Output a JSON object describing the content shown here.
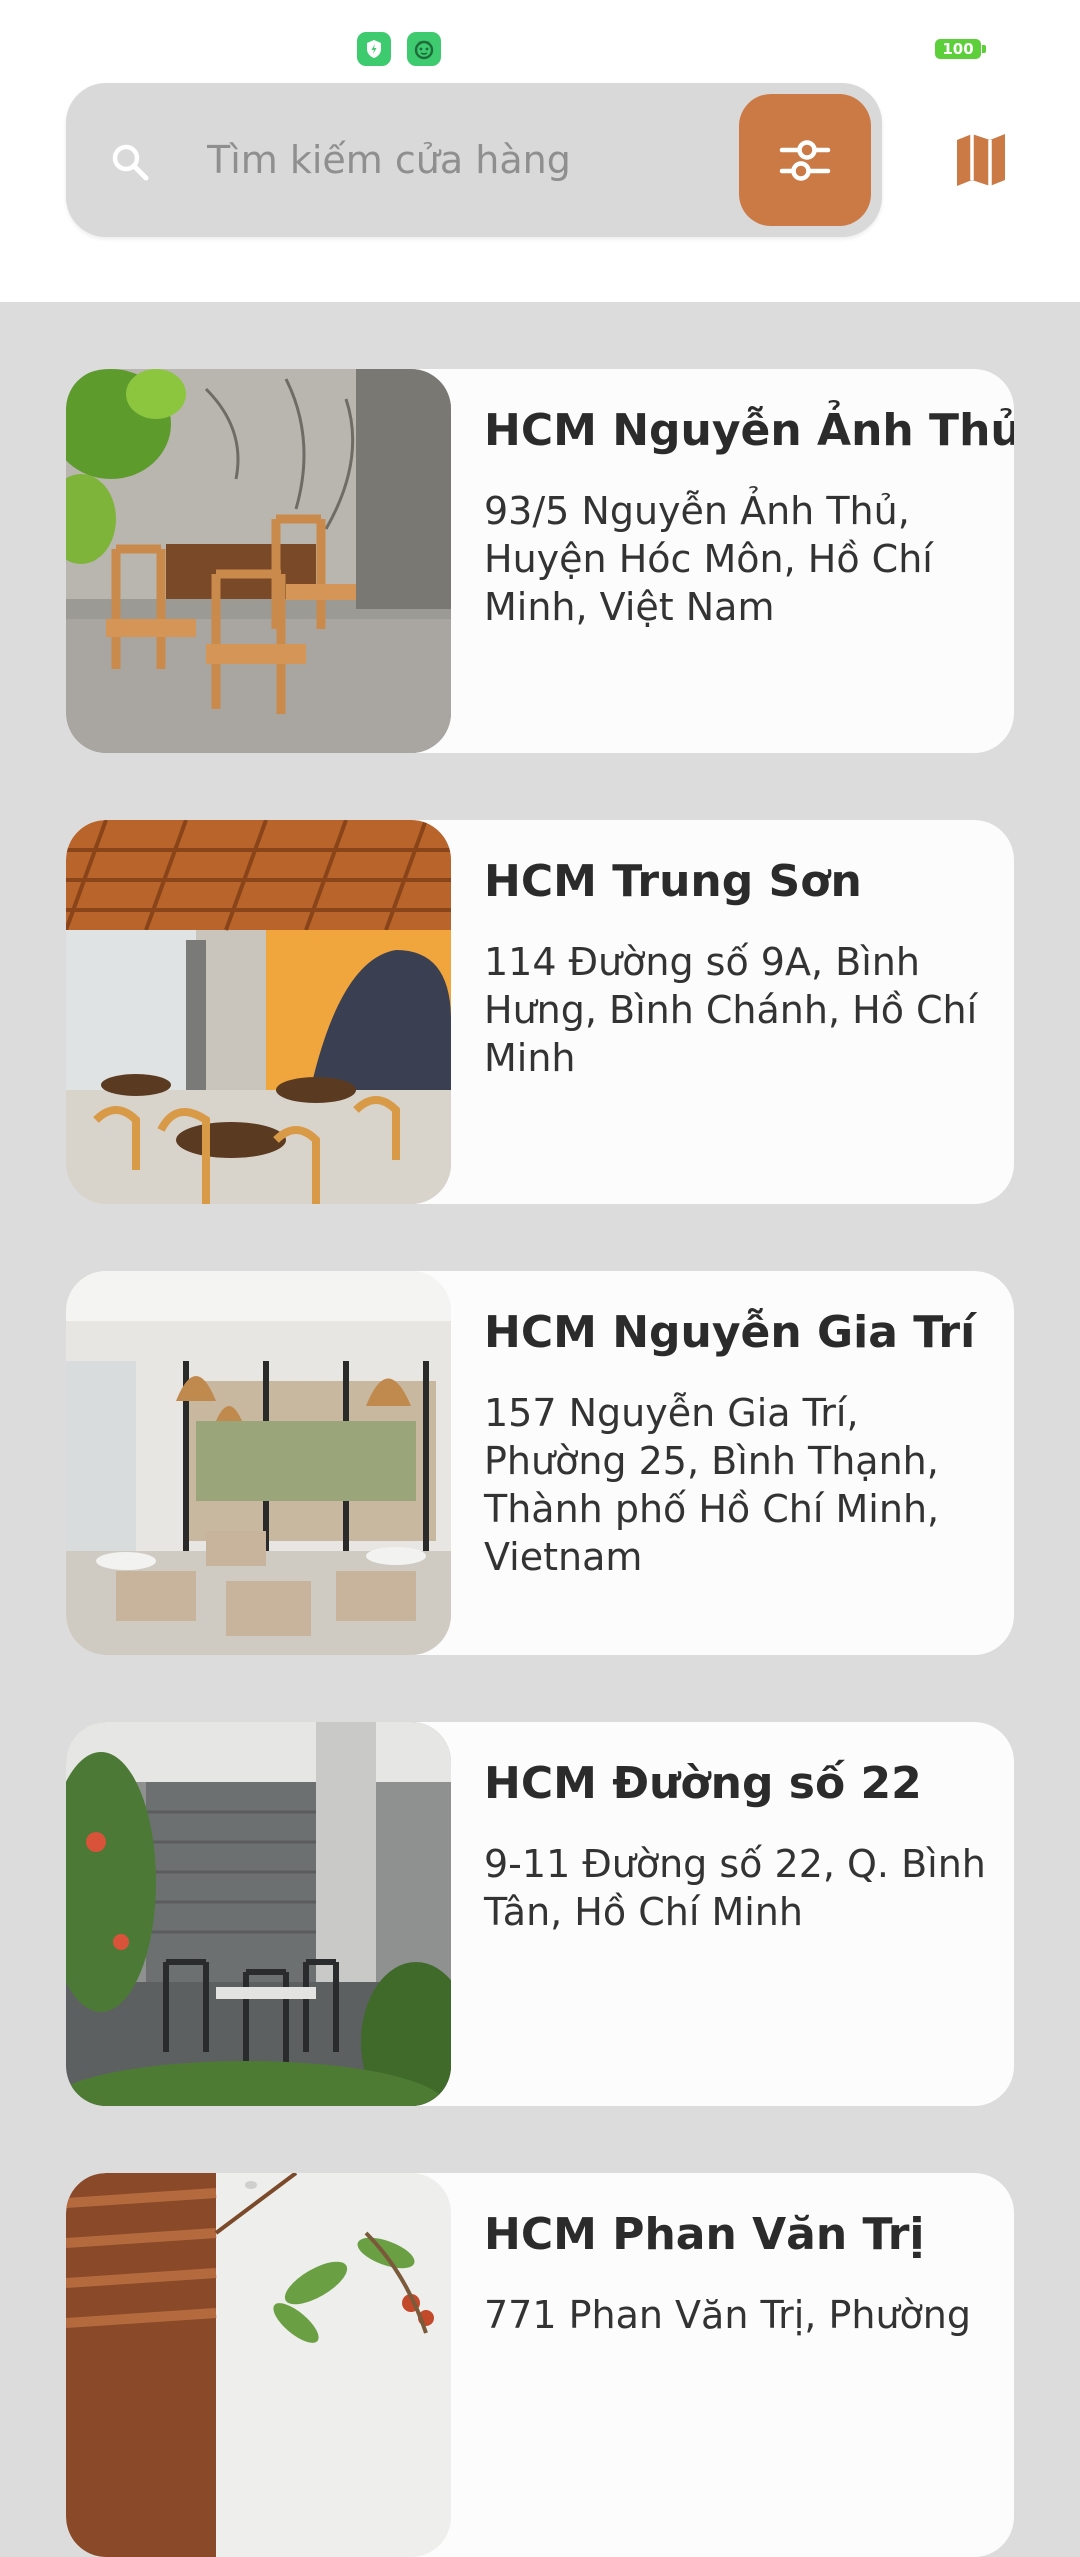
{
  "status_bar": {
    "battery_level": "100",
    "notification_icons": [
      "shield-icon",
      "android-icon"
    ],
    "icon_color": "#3ecb70",
    "battery_color": "#5ccf3b"
  },
  "search": {
    "placeholder": "Tìm kiếm cửa hàng",
    "value": "",
    "search_icon": "search-icon",
    "filter_icon": "sliders-icon",
    "map_icon": "map-icon"
  },
  "theme": {
    "accent": "#cb7a45",
    "background": "#dcdcdc",
    "card": "#fcfcfc"
  },
  "stores": [
    {
      "name": "HCM Nguyễn Ảnh Thủ",
      "address": "93/5 Nguyễn Ảnh Thủ, Huyện Hóc Môn, Hồ Chí Minh, Việt Nam",
      "image": "cafe-interior-photo"
    },
    {
      "name": "HCM Trung Sơn",
      "address": "114 Đường số 9A, Bình Hưng, Bình Chánh, Hồ Chí Minh",
      "image": "cafe-interior-photo"
    },
    {
      "name": "HCM Nguyễn Gia Trí",
      "address": "157 Nguyễn Gia Trí, Phường 25, Bình Thạnh, Thành phố Hồ Chí Minh, Vietnam",
      "image": "cafe-interior-photo"
    },
    {
      "name": "HCM Đường số 22",
      "address": "9-11 Đường số 22, Q. Bình Tân, Hồ Chí Minh",
      "image": "cafe-exterior-photo"
    },
    {
      "name": "HCM Phan Văn Trị",
      "address": "771 Phan Văn Trị, Phường",
      "image": "cafe-interior-photo"
    }
  ]
}
